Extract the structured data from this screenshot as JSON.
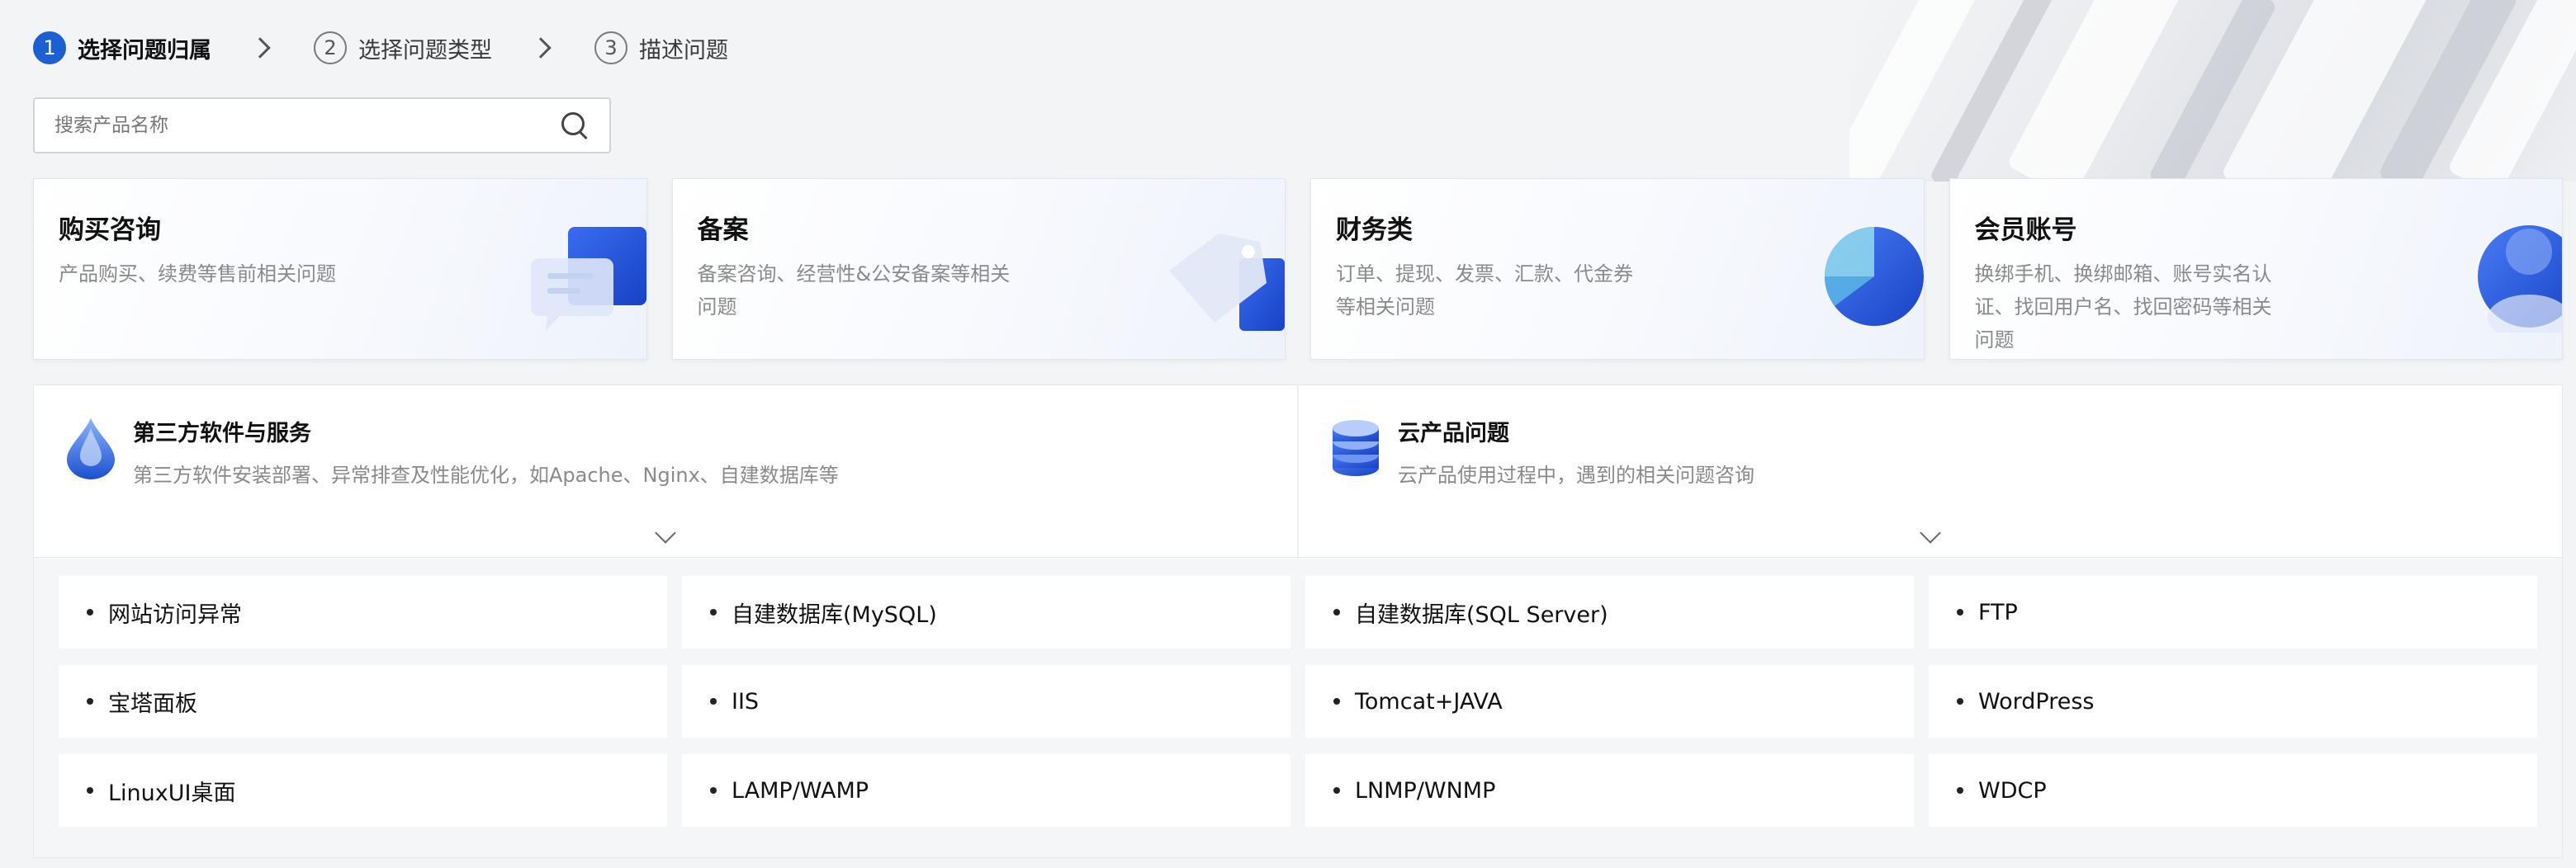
{
  "steps": [
    {
      "num": "1",
      "label": "选择问题归属",
      "active": true
    },
    {
      "num": "2",
      "label": "选择问题类型",
      "active": false
    },
    {
      "num": "3",
      "label": "描述问题",
      "active": false
    }
  ],
  "search": {
    "placeholder": "搜索产品名称",
    "icon": "search-icon"
  },
  "cards": [
    {
      "title": "购买咨询",
      "desc": "产品购买、续费等售前相关问题",
      "icon": "chat-bubble-icon"
    },
    {
      "title": "备案",
      "desc": "备案咨询、经营性&公安备案等相关问题",
      "icon": "tag-icon"
    },
    {
      "title": "财务类",
      "desc": "订单、提现、发票、汇款、代金券等相关问题",
      "icon": "pie-chart-icon"
    },
    {
      "title": "会员账号",
      "desc": "换绑手机、换绑邮箱、账号实名认证、找回用户名、找回密码等相关问题",
      "icon": "user-icon"
    }
  ],
  "panels": [
    {
      "title": "第三方软件与服务",
      "desc": "第三方软件安装部署、异常排查及性能优化，如Apache、Nginx、自建数据库等",
      "icon": "droplet-icon"
    },
    {
      "title": "云产品问题",
      "desc": "云产品使用过程中，遇到的相关问题咨询",
      "icon": "database-icon"
    }
  ],
  "issues": [
    "网站访问异常",
    "自建数据库(MySQL)",
    "自建数据库(SQL Server)",
    "FTP",
    "宝塔面板",
    "IIS",
    "Tomcat+JAVA",
    "WordPress",
    "LinuxUI桌面",
    "LAMP/WAMP",
    "LNMP/WNMP",
    "WDCP"
  ],
  "colors": {
    "accent": "#1b5fd1",
    "icon_blue": "#2d5be3"
  }
}
